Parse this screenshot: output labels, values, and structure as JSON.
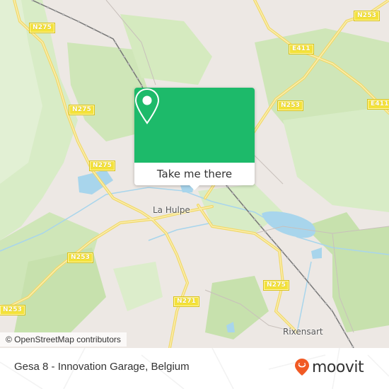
{
  "map": {
    "road_labels": [
      {
        "id": "n275-a",
        "text": "N275"
      },
      {
        "id": "n275-b",
        "text": "N275"
      },
      {
        "id": "n275-c",
        "text": "N275"
      },
      {
        "id": "n253-a",
        "text": "N253"
      },
      {
        "id": "n253-b",
        "text": "N253"
      },
      {
        "id": "n253-c",
        "text": "N253"
      },
      {
        "id": "n253-d",
        "text": "N253"
      },
      {
        "id": "e411-a",
        "text": "E411"
      },
      {
        "id": "e411-b",
        "text": "E411"
      },
      {
        "id": "n271",
        "text": "N271"
      },
      {
        "id": "n275-d",
        "text": "N275"
      }
    ],
    "place_labels": {
      "la_hulpe": "La Hulpe",
      "rixensart": "Rixensart"
    },
    "attribution": "© OpenStreetMap contributors"
  },
  "popup": {
    "icon": "map-pin-icon",
    "button_label": "Take me there",
    "color": "#1dba6a"
  },
  "footer": {
    "title": "Gesa 8 - Innovation Garage, Belgium",
    "logo_text": "moovit",
    "logo_color": "#f15a24"
  }
}
